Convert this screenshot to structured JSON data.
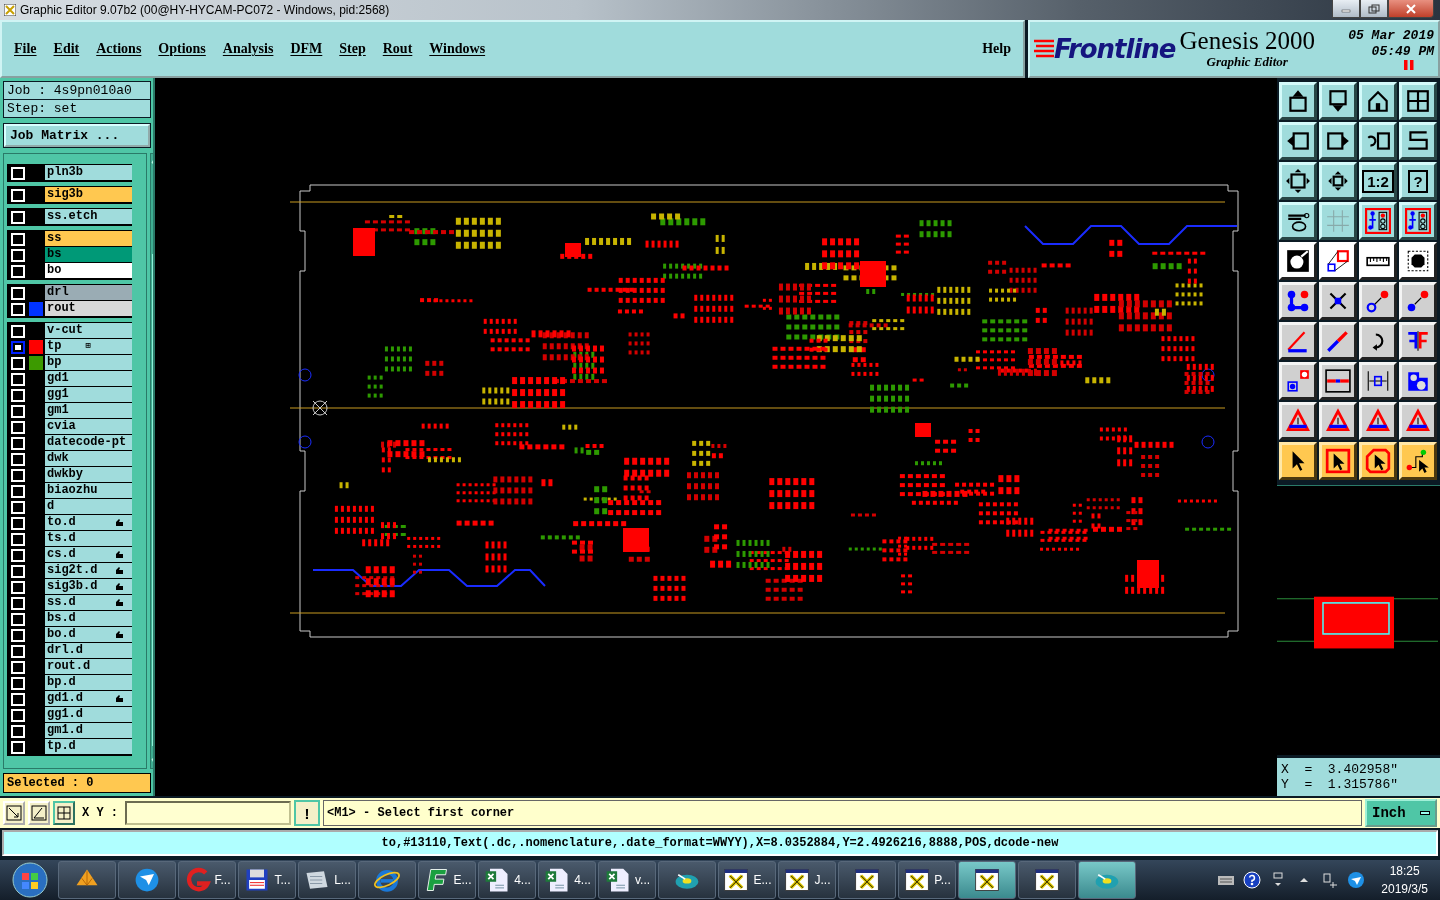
{
  "window": {
    "title": "Graphic Editor 9.07b2 (00@HY-HYCAM-PC072 - Windows, pid:2568)"
  },
  "menu": [
    "File",
    "Edit",
    "Actions",
    "Options",
    "Analysis",
    "DFM",
    "Step",
    "Rout",
    "Windows"
  ],
  "help_menu": "Help",
  "brand": {
    "logo": "Frontline",
    "product": "Genesis 2000",
    "subtitle": "Graphic Editor",
    "date": "05 Mar 2019",
    "time": "05:49 PM"
  },
  "job": {
    "job_label": "Job  :  4s9pn010a0",
    "step_label": "Step:  set",
    "matrix_button": "Job Matrix ..."
  },
  "layer_groups": [
    [
      {
        "name": "pln3b",
        "kind": "misc",
        "hand": false,
        "selected": false
      }
    ],
    [
      {
        "name": "sig3b",
        "kind": "signal",
        "hand": false,
        "selected": false
      }
    ],
    [
      {
        "name": "ss.etch",
        "kind": "misc",
        "hand": false,
        "selected": false
      }
    ],
    [
      {
        "name": "ss",
        "kind": "signal",
        "hand": false,
        "selected": false
      },
      {
        "name": "bs",
        "kind": "mask",
        "hand": false,
        "selected": false
      },
      {
        "name": "bo",
        "kind": "silk",
        "hand": false,
        "selected": false
      }
    ],
    [
      {
        "name": "drl",
        "kind": "drill",
        "hand": false,
        "selected": false
      },
      {
        "name": "rout",
        "kind": "rout",
        "color": "#0033ff",
        "hand": false,
        "selected": false
      }
    ],
    [
      {
        "name": "v-cut",
        "kind": "misc",
        "hand": false,
        "selected": false
      },
      {
        "name": "tp",
        "kind": "misc",
        "color": "#ff0000",
        "badge": "⊞",
        "hand": false,
        "selected": true
      },
      {
        "name": "bp",
        "kind": "misc",
        "color": "#3c9a00",
        "hand": false,
        "selected": false
      },
      {
        "name": "gd1",
        "kind": "misc",
        "hand": false,
        "selected": false
      },
      {
        "name": "gg1",
        "kind": "misc",
        "hand": false,
        "selected": false
      },
      {
        "name": "gm1",
        "kind": "misc",
        "hand": false,
        "selected": false
      },
      {
        "name": "cvia",
        "kind": "misc",
        "hand": false,
        "selected": false
      },
      {
        "name": "datecode-pt",
        "kind": "misc",
        "hand": false,
        "selected": false
      },
      {
        "name": "dwk",
        "kind": "misc",
        "hand": false,
        "selected": false
      },
      {
        "name": "dwkby",
        "kind": "misc",
        "hand": false,
        "selected": false
      },
      {
        "name": "biaozhu",
        "kind": "misc",
        "hand": false,
        "selected": false
      },
      {
        "name": "d",
        "kind": "misc",
        "hand": false,
        "selected": false
      },
      {
        "name": "to.d",
        "kind": "misc",
        "hand": true,
        "selected": false
      },
      {
        "name": "ts.d",
        "kind": "misc",
        "hand": false,
        "selected": false
      },
      {
        "name": "cs.d",
        "kind": "misc",
        "hand": true,
        "selected": false
      },
      {
        "name": "sig2t.d",
        "kind": "misc",
        "hand": true,
        "selected": false
      },
      {
        "name": "sig3b.d",
        "kind": "misc",
        "hand": true,
        "selected": false
      },
      {
        "name": "ss.d",
        "kind": "misc",
        "hand": true,
        "selected": false
      },
      {
        "name": "bs.d",
        "kind": "misc",
        "hand": false,
        "selected": false
      },
      {
        "name": "bo.d",
        "kind": "misc",
        "hand": true,
        "selected": false
      },
      {
        "name": "drl.d",
        "kind": "misc",
        "hand": false,
        "selected": false
      },
      {
        "name": "rout.d",
        "kind": "misc",
        "hand": false,
        "selected": false
      },
      {
        "name": "bp.d",
        "kind": "misc",
        "hand": false,
        "selected": false
      },
      {
        "name": "gd1.d",
        "kind": "misc",
        "hand": true,
        "selected": false
      },
      {
        "name": "gg1.d",
        "kind": "misc",
        "hand": false,
        "selected": false
      },
      {
        "name": "gm1.d",
        "kind": "misc",
        "hand": false,
        "selected": false
      },
      {
        "name": "tp.d",
        "kind": "misc",
        "hand": false,
        "selected": false
      }
    ]
  ],
  "selected_count": "Selected : 0",
  "toolbar": [
    {
      "kind": "up"
    },
    {
      "kind": "down"
    },
    {
      "kind": "house"
    },
    {
      "kind": "window"
    },
    {
      "kind": "left"
    },
    {
      "kind": "right"
    },
    {
      "kind": "undo"
    },
    {
      "kind": "curve"
    },
    {
      "kind": "fit"
    },
    {
      "kind": "center"
    },
    {
      "kind": "text",
      "label": "1:2"
    },
    {
      "kind": "text",
      "label": "?"
    },
    {
      "kind": "tools"
    },
    {
      "kind": "grid"
    },
    {
      "kind": "board"
    },
    {
      "kind": "board"
    },
    {
      "kind": "fill"
    },
    {
      "kind": "scale"
    },
    {
      "kind": "ruler"
    },
    {
      "kind": "octagon"
    },
    {
      "kind": "nodes"
    },
    {
      "kind": "cross"
    },
    {
      "kind": "ring-move"
    },
    {
      "kind": "dot-move"
    },
    {
      "kind": "line-edit"
    },
    {
      "kind": "line-split"
    },
    {
      "kind": "rotate"
    },
    {
      "kind": "mirror"
    },
    {
      "kind": "box-move"
    },
    {
      "kind": "line-join"
    },
    {
      "kind": "spacing"
    },
    {
      "kind": "shapes"
    },
    {
      "kind": "triangle"
    },
    {
      "kind": "triangle"
    },
    {
      "kind": "triangle"
    },
    {
      "kind": "triangle"
    },
    {
      "kind": "pointer"
    },
    {
      "kind": "pointer-box"
    },
    {
      "kind": "pointer-octagon"
    },
    {
      "kind": "route"
    }
  ],
  "coordinates": {
    "x": "X  =  3.402958\"",
    "y": "Y  =  1.315786\""
  },
  "command": {
    "xy_label": "X Y :",
    "alert": "!",
    "prompt": "<M1> - Select first corner",
    "units": "Inch"
  },
  "status_line": "to,#13110,Text(.dc,.nomenclature,.date_format=WWYY),X=8.0352884,Y=2.4926216,8888,POS,dcode-new",
  "taskbar": [
    {
      "selected": false
    },
    {
      "selected": false
    },
    {
      "label": "F...",
      "selected": false
    },
    {
      "label": "T...",
      "selected": false
    },
    {
      "label": "L...",
      "selected": false
    },
    {
      "selected": false
    },
    {
      "label": "E...",
      "selected": false
    },
    {
      "label": "4...",
      "selected": false
    },
    {
      "label": "4...",
      "selected": false
    },
    {
      "label": "v...",
      "selected": false
    },
    {
      "selected": false
    },
    {
      "label": "E...",
      "selected": false
    },
    {
      "label": "J...",
      "selected": false
    },
    {
      "selected": false
    },
    {
      "label": "P...",
      "selected": false
    },
    {
      "selected": true
    },
    {
      "selected": false
    },
    {
      "selected": true
    }
  ],
  "clock": {
    "time": "18:25",
    "date": "2019/3/5"
  }
}
